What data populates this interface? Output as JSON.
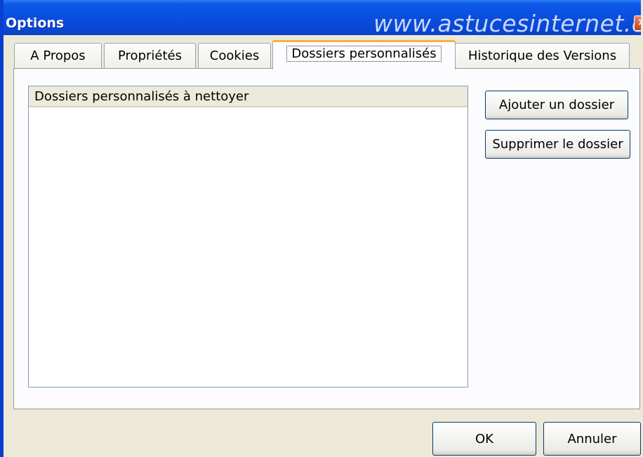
{
  "window": {
    "title": "Options",
    "watermark": "www.astucesinternet.com",
    "close_label": "×"
  },
  "tabs": [
    {
      "label": "A Propos"
    },
    {
      "label": "Propriétés"
    },
    {
      "label": "Cookies"
    },
    {
      "label": "Dossiers personnalisés",
      "active": true
    },
    {
      "label": "Historique des Versions"
    }
  ],
  "panel": {
    "list_header": "Dossiers personnalisés à nettoyer",
    "add_button": "Ajouter un dossier",
    "remove_button": "Supprimer le dossier"
  },
  "footer": {
    "ok_label": "OK",
    "cancel_label": "Annuler"
  }
}
